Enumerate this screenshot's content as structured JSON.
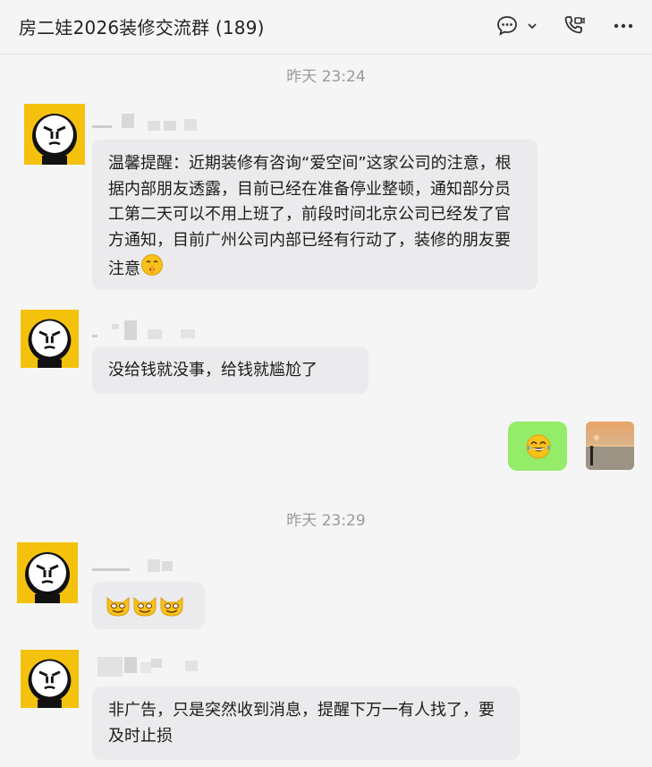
{
  "header": {
    "title": "房二娃2026装修交流群 (189)",
    "icons": [
      "chat-bubble-icon",
      "chevron-down-icon",
      "video-call-icon",
      "more-icon"
    ]
  },
  "messages": [
    {
      "type": "timestamp",
      "text": "昨天 23:24"
    },
    {
      "type": "incoming",
      "text": "温馨提醒：近期装修有咨询“爱空间”这家公司的注意，根据内部朋友透露，目前已经在准备停业整顿，通知部分员工第二天可以不用上班了，前段时间北京公司已经发了官方通知，目前广州公司内部已经有行动了，装修的朋友要注意",
      "trailing_emoji": "shushing-face-emoji"
    },
    {
      "type": "incoming",
      "text": "没给钱就没事，给钱就尴尬了"
    },
    {
      "type": "outgoing",
      "emoji": "tears-of-joy-emoji"
    },
    {
      "type": "timestamp",
      "text": "昨天 23:29"
    },
    {
      "type": "incoming",
      "emojis": [
        "grinning-cat-emoji",
        "grinning-cat-emoji",
        "grinning-cat-emoji"
      ]
    },
    {
      "type": "incoming",
      "text": "非广告，只是突然收到消息，提醒下万一有人找了，要及时止损"
    }
  ],
  "colors": {
    "background": "#f5f5f6",
    "incoming_bubble": "#ebebee",
    "outgoing_bubble": "#95ec69",
    "timestamp": "#9a9a9a"
  }
}
